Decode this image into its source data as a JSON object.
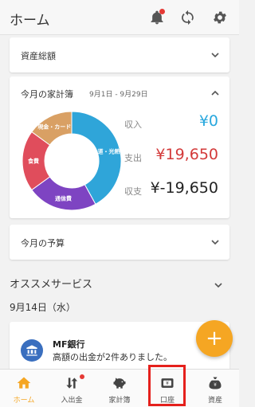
{
  "header": {
    "title": "ホーム",
    "icons": [
      "bell-icon",
      "sync-icon",
      "gear-icon"
    ],
    "accent": "#f5a623"
  },
  "asset_card": {
    "title": "資産総額"
  },
  "kakeibo": {
    "title": "今月の家計簿",
    "date_range": "9月1日 - 9月29日",
    "income_label": "収入",
    "income_value": "¥0",
    "expense_label": "支出",
    "expense_value": "¥19,650",
    "balance_label": "収支",
    "balance_value": "¥-19,650",
    "income_color": "#29a8de",
    "expense_color": "#d33a3a"
  },
  "chart_data": {
    "type": "pie",
    "categories": [
      "水道・光熱費",
      "通信費",
      "食費",
      "現金・カード"
    ],
    "slice_labels": [
      "道・光熱",
      "通信費",
      "食費",
      "現金・カード"
    ],
    "values": [
      42,
      23,
      20,
      15
    ],
    "colors": [
      "#2fa5d9",
      "#7e44c2",
      "#e04d5c",
      "#d9a064"
    ]
  },
  "budget_card": {
    "title": "今月の予算"
  },
  "recommended": {
    "title": "オススメサービス"
  },
  "date_header": "9月14日（水）",
  "notice": {
    "bank_name": "MF銀行",
    "message": "高額の出金が2件ありました。"
  },
  "fab_label": "+",
  "nav": {
    "items": [
      {
        "label": "ホーム",
        "icon": "home-icon"
      },
      {
        "label": "入出金",
        "icon": "transfer-icon"
      },
      {
        "label": "家計簿",
        "icon": "piggy-bank-icon"
      },
      {
        "label": "口座",
        "icon": "wallet-icon"
      },
      {
        "label": "資産",
        "icon": "money-bag-icon"
      }
    ],
    "yen_symbol": "¥"
  }
}
